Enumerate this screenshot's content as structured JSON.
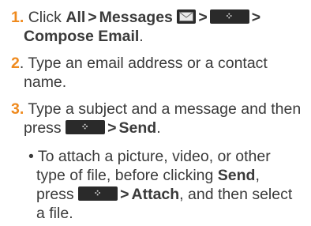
{
  "steps": [
    {
      "number": "1.",
      "text": {
        "click": "Click",
        "all": "All",
        "messages": "Messages",
        "compose_email": "Compose Email",
        "period": "."
      }
    },
    {
      "number": "2",
      "text": {
        "line1": ". Type an email address or a contact",
        "line2": "name."
      }
    },
    {
      "number": "3.",
      "text": {
        "line1": "Type a subject and a message and then",
        "press": "press",
        "send": "Send",
        "period": "."
      }
    }
  ],
  "sub_bullet": {
    "bullet": "•",
    "line1": "To attach a picture, video, or other",
    "line2_pre": "type of file, before clicking",
    "send": "Send",
    "comma": ",",
    "press": "press",
    "attach": "Attach",
    "line3_post": ", and then select",
    "line4": "a file."
  },
  "separator": ">",
  "icons": {
    "blackberry_key": "blackberry-menu-key-icon",
    "mail": "envelope-icon"
  }
}
